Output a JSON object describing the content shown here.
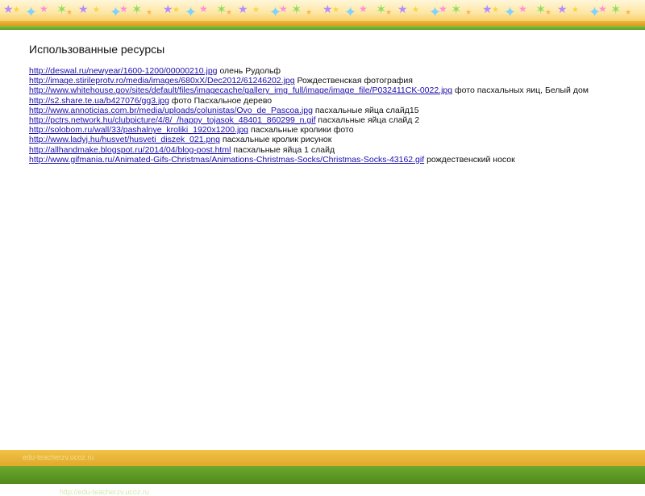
{
  "theme": {
    "banner_star_colors": [
      "#b48cff",
      "#ffd23a",
      "#7fd1ff",
      "#ff8fd6",
      "#8fdc5a",
      "#ffb347"
    ]
  },
  "page": {
    "title": "Использованные ресурсы"
  },
  "references": [
    {
      "url": "http://deswal.ru/newyear/1600-1200/00000210.jpg",
      "description": "олень Рудольф"
    },
    {
      "url": "http://image.stirileprotv.ro/media/images/680xX/Dec2012/61246202.jpg",
      "description": "Рождественская фотография"
    },
    {
      "url": "http://www.whitehouse.gov/sites/default/files/imagecache/gallery_img_full/image/image_file/P032411CK-0022.jpg",
      "description": "фото пасхальных яиц, Белый дом"
    },
    {
      "url": "http://s2.share.te.ua/b427076/gg3.jpg",
      "description": "фото Пасхальное дерево"
    },
    {
      "url": "http://www.annoticias.com.br/media/uploads/colunistas/Ovo_de_Pascoa.jpg",
      "description": "пасхальные яйца слайд15"
    },
    {
      "url": "http://pctrs.network.hu/clubpicture/4/8/_/happy_tojasok_48401_860299_n.gif",
      "description": "пасхальные яйца слайд 2"
    },
    {
      "url": "http://solobom.ru/wall/33/pashalnye_kroliki_1920x1200.jpg",
      "description": "пасхальные кролики фото"
    },
    {
      "url": "http://www.ladyj.hu/husvet/husveti_diszek_021.png",
      "description": "пасхальные кролик рисунок"
    },
    {
      "url": "http://allhandmake.blogspot.ru/2014/04/blog-post.html",
      "description": "пасхальные яйца 1 слайд"
    },
    {
      "url": "http://www.gifmania.ru/Animated-Gifs-Christmas/Animations-Christmas-Socks/Christmas-Socks-43162.gif",
      "description": "рождественский носок"
    }
  ],
  "footer": {
    "site": "edu-teacherzv.ucoz.ru",
    "url": "http://edu-teacherzv.ucoz.ru"
  }
}
